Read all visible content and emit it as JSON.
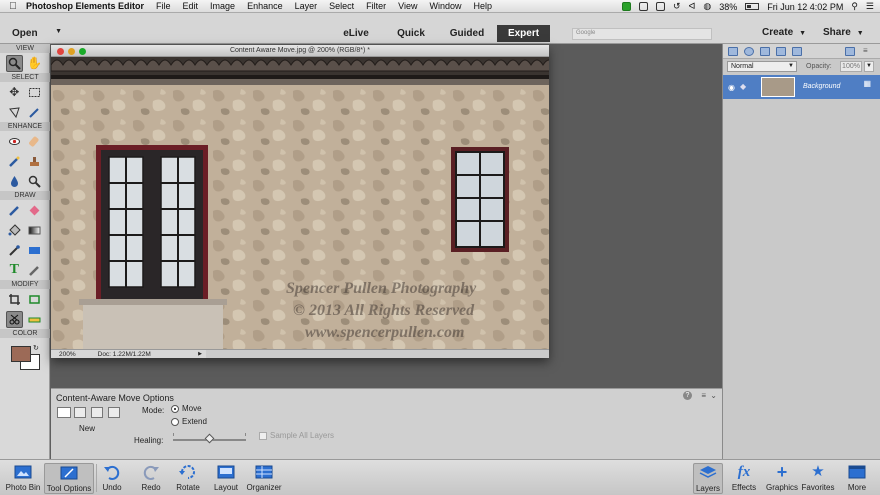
{
  "menubar": {
    "app_name": "Photoshop Elements Editor",
    "menus": [
      "File",
      "Edit",
      "Image",
      "Enhance",
      "Layer",
      "Select",
      "Filter",
      "View",
      "Window",
      "Help"
    ],
    "battery": "38%",
    "clock": "Fri Jun 12  4:02 PM"
  },
  "appbar": {
    "open_label": "Open",
    "modes": [
      "eLive",
      "Quick",
      "Guided",
      "Expert"
    ],
    "active_mode": "Expert",
    "search_placeholder": "Google",
    "create_label": "Create",
    "share_label": "Share"
  },
  "toolbox": {
    "sections": [
      "VIEW",
      "SELECT",
      "ENHANCE",
      "DRAW",
      "MODIFY",
      "COLOR"
    ],
    "foreground_color": "#9c6a57",
    "background_color": "#ffffff"
  },
  "document": {
    "title": "Content Aware Move.jpg @ 200% (RGB/8*) *",
    "zoom": "200%",
    "doc_size": "Doc: 1.22M/1.22M",
    "watermark": [
      "Spencer Pullen Photography",
      "© 2013 All Rights Reserved",
      "www.spencerpullen.com"
    ]
  },
  "tool_options": {
    "title": "Content-Aware Move Options",
    "new_label": "New",
    "mode_label": "Mode:",
    "mode_options": [
      "Move",
      "Extend"
    ],
    "selected_mode": "Move",
    "healing_label": "Healing:",
    "healing_level": 0.5,
    "sample_all_layers": "Sample All Layers"
  },
  "layers": {
    "blend_mode": "Normal",
    "opacity_label": "Opacity:",
    "opacity_value": "100%",
    "items": [
      {
        "name": "Background"
      }
    ]
  },
  "taskbar": {
    "left": [
      "Photo Bin",
      "Tool Options",
      "Undo",
      "Redo",
      "Rotate",
      "Layout",
      "Organizer"
    ],
    "right": [
      "Layers",
      "Effects",
      "Graphics",
      "Favorites",
      "More"
    ]
  },
  "colors": {
    "active_tab": "#3a3a3a",
    "selected_layer": "#4f7ec4"
  }
}
